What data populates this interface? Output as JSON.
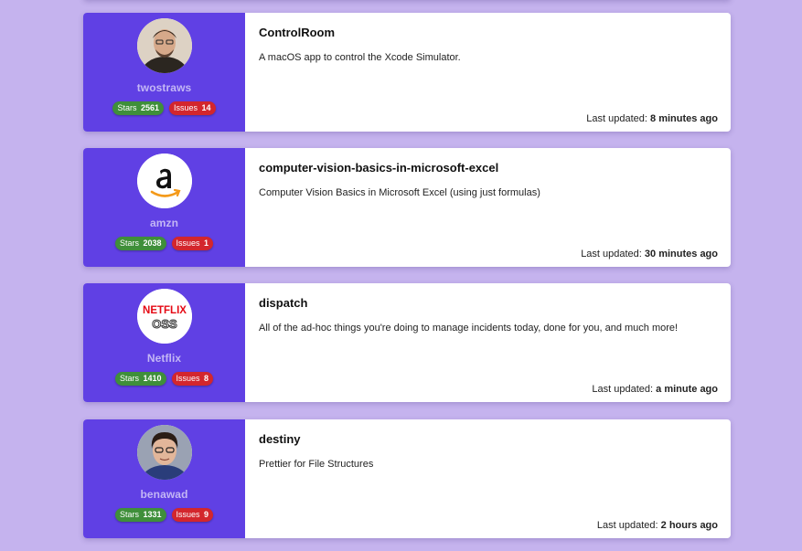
{
  "updated_prefix": "Last updated:",
  "stars_label": "Stars",
  "issues_label": "Issues",
  "colors": {
    "background": "#c5b3ee",
    "owner_panel": "#6040e4",
    "stars_badge": "#3f8f3a",
    "issues_badge": "#d3262d"
  },
  "repos": [
    {
      "owner": "twostraws",
      "avatar": "person-photo",
      "stars": "2561",
      "issues": "14",
      "name": "ControlRoom",
      "description": "A macOS app to control the Xcode Simulator.",
      "updated": "8 minutes ago"
    },
    {
      "owner": "amzn",
      "avatar": "amazon-logo",
      "stars": "2038",
      "issues": "1",
      "name": "computer-vision-basics-in-microsoft-excel",
      "description": "Computer Vision Basics in Microsoft Excel (using just formulas)",
      "updated": "30 minutes ago"
    },
    {
      "owner": "Netflix",
      "avatar": "netflix-oss-logo",
      "avatar_text": [
        "NETFLIX",
        "OSS"
      ],
      "stars": "1410",
      "issues": "8",
      "name": "dispatch",
      "description": "All of the ad-hoc things you're doing to manage incidents today, done for you, and much more!",
      "updated": "a minute ago"
    },
    {
      "owner": "benawad",
      "avatar": "person-photo",
      "stars": "1331",
      "issues": "9",
      "name": "destiny",
      "description": "Prettier for File Structures",
      "updated": "2 hours ago"
    }
  ]
}
